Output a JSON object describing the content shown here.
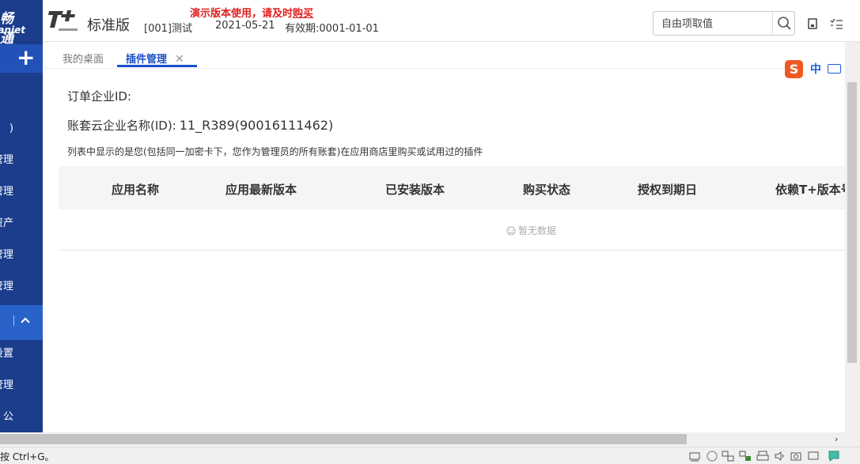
{
  "brand": {
    "logo_line1": "畅 通",
    "logo_line2": "anjet"
  },
  "header": {
    "edition": "标准版",
    "company": "[001]测试",
    "date": "2021-05-21",
    "valid": "有效期:0001-01-01",
    "demo_notice": "演示版本使用，请及时",
    "demo_buy": "购买",
    "search_placeholder": "自由项取值"
  },
  "sidebar": {
    "items": [
      {
        "label": ")"
      },
      {
        "label": "管理"
      },
      {
        "label": "管理"
      },
      {
        "label": "资产"
      },
      {
        "label": "管理"
      },
      {
        "label": "管理"
      },
      {
        "label": "设置"
      },
      {
        "label": "管理"
      },
      {
        "label": "公"
      }
    ]
  },
  "tabs": [
    {
      "label": "我的桌面"
    },
    {
      "label": "插件管理"
    }
  ],
  "ime": {
    "label": "中"
  },
  "content": {
    "order_label": "订单企业ID:",
    "account_label": "账套云企业名称(ID):",
    "account_value": "11_R389(90016111462)",
    "note": "列表中显示的是您(包括同一加密卡下，您作为管理员的所有账套)在应用商店里购买或试用过的插件",
    "columns": [
      "应用名称",
      "应用最新版本",
      "已安装版本",
      "购买状态",
      "授权到期日",
      "依赖T+版本号"
    ],
    "empty_text": "暂无数据"
  },
  "statusbar": {
    "text": "按 Ctrl+G。"
  },
  "colors": {
    "nav_bg": "#1b3d8c",
    "nav_active": "#2962c9",
    "accent": "#1b50c8",
    "demo_red": "#e02020"
  }
}
